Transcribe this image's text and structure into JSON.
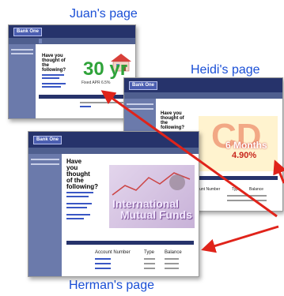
{
  "captions": {
    "juan": "Juan's page",
    "heidi": "Heidi's page",
    "herman": "Herman's page"
  },
  "logo_text": "Bank One",
  "question": "Have you thought of the following?",
  "juan_promo": {
    "big": "30 yr",
    "small": "Fixed APR 6.5%"
  },
  "heidi_promo": {
    "big": "CD",
    "mid": "6 Months",
    "rate": "4.90%"
  },
  "herman_promo": {
    "line1": "International",
    "line2": "Mutual Funds"
  },
  "table_headers": [
    "Account Number",
    "Type",
    "Balance"
  ],
  "colors": {
    "caption": "#1a4fd6",
    "arrow": "#e0231a",
    "header": "#26336b"
  }
}
